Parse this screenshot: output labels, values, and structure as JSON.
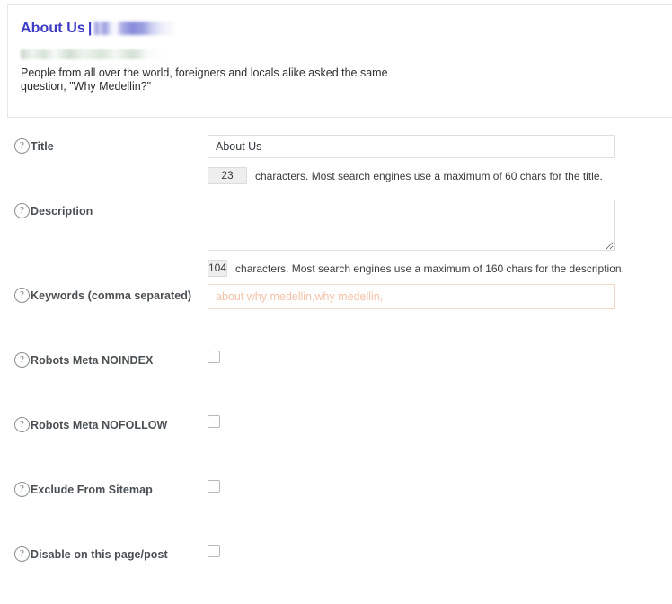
{
  "preview": {
    "title_text": "About Us",
    "title_separator": "|",
    "title_blurred_site": "",
    "url_blurred": "",
    "description": "People from all over the world, foreigners and locals alike asked the same question, \"Why Medellin?\"",
    "title_color": "#3b3bc4"
  },
  "help_icon_glyph": "?",
  "fields": {
    "title": {
      "label": "Title",
      "help_icon": "help-circle-icon",
      "value": "About Us",
      "placeholder": "",
      "counter": "23",
      "counter_note": "characters. Most search engines use a maximum of 60 chars for the title."
    },
    "description": {
      "label": "Description",
      "help_icon": "help-circle-icon",
      "value": "",
      "placeholder": "",
      "counter": "104",
      "counter_note": "characters. Most search engines use a maximum of 160 chars for the description."
    },
    "keywords": {
      "label": "Keywords (comma separated)",
      "help_icon": "help-circle-icon",
      "value": "",
      "placeholder": "about why medellin,why medellin,",
      "text_color": "#f3c2a8",
      "border_color": "#f4d6c6"
    }
  },
  "checkboxes": [
    {
      "label": "Robots Meta NOINDEX",
      "help_icon": "help-circle-icon",
      "checked": false
    },
    {
      "label": "Robots Meta NOFOLLOW",
      "help_icon": "help-circle-icon",
      "checked": false
    },
    {
      "label": "Exclude From Sitemap",
      "help_icon": "help-circle-icon",
      "checked": false
    },
    {
      "label": "Disable on this page/post",
      "help_icon": "help-circle-icon",
      "checked": false
    }
  ]
}
